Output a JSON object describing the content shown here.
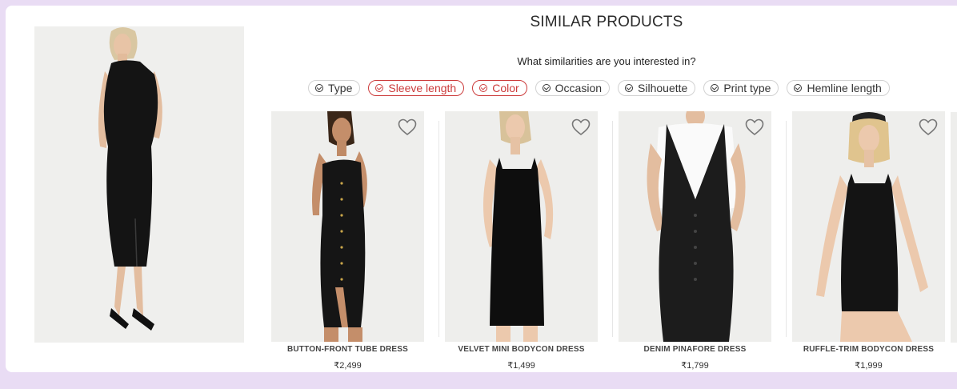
{
  "header": {
    "title": "SIMILAR PRODUCTS",
    "subtitle": "What similarities are you interested in?"
  },
  "chips": [
    {
      "label": "Type",
      "active": false
    },
    {
      "label": "Sleeve length",
      "active": true
    },
    {
      "label": "Color",
      "active": true
    },
    {
      "label": "Occasion",
      "active": false
    },
    {
      "label": "Silhouette",
      "active": false
    },
    {
      "label": "Print type",
      "active": false
    },
    {
      "label": "Hemline length",
      "active": false
    }
  ],
  "products": [
    {
      "name": "BUTTON-FRONT TUBE DRESS",
      "price": "₹2,499"
    },
    {
      "name": "VELVET MINI BODYCON DRESS",
      "price": "₹1,499"
    },
    {
      "name": "DENIM PINAFORE DRESS",
      "price": "₹1,799"
    },
    {
      "name": "RUFFLE-TRIM BODYCON DRESS",
      "price": "₹1,999"
    }
  ],
  "colors": {
    "page_background": "#e9dcf4",
    "active_chip": "#cc3b3b",
    "photo_background": "#eeeeec"
  },
  "icons": {
    "chip": "check-circle-icon",
    "wishlist": "heart-outline-icon"
  }
}
